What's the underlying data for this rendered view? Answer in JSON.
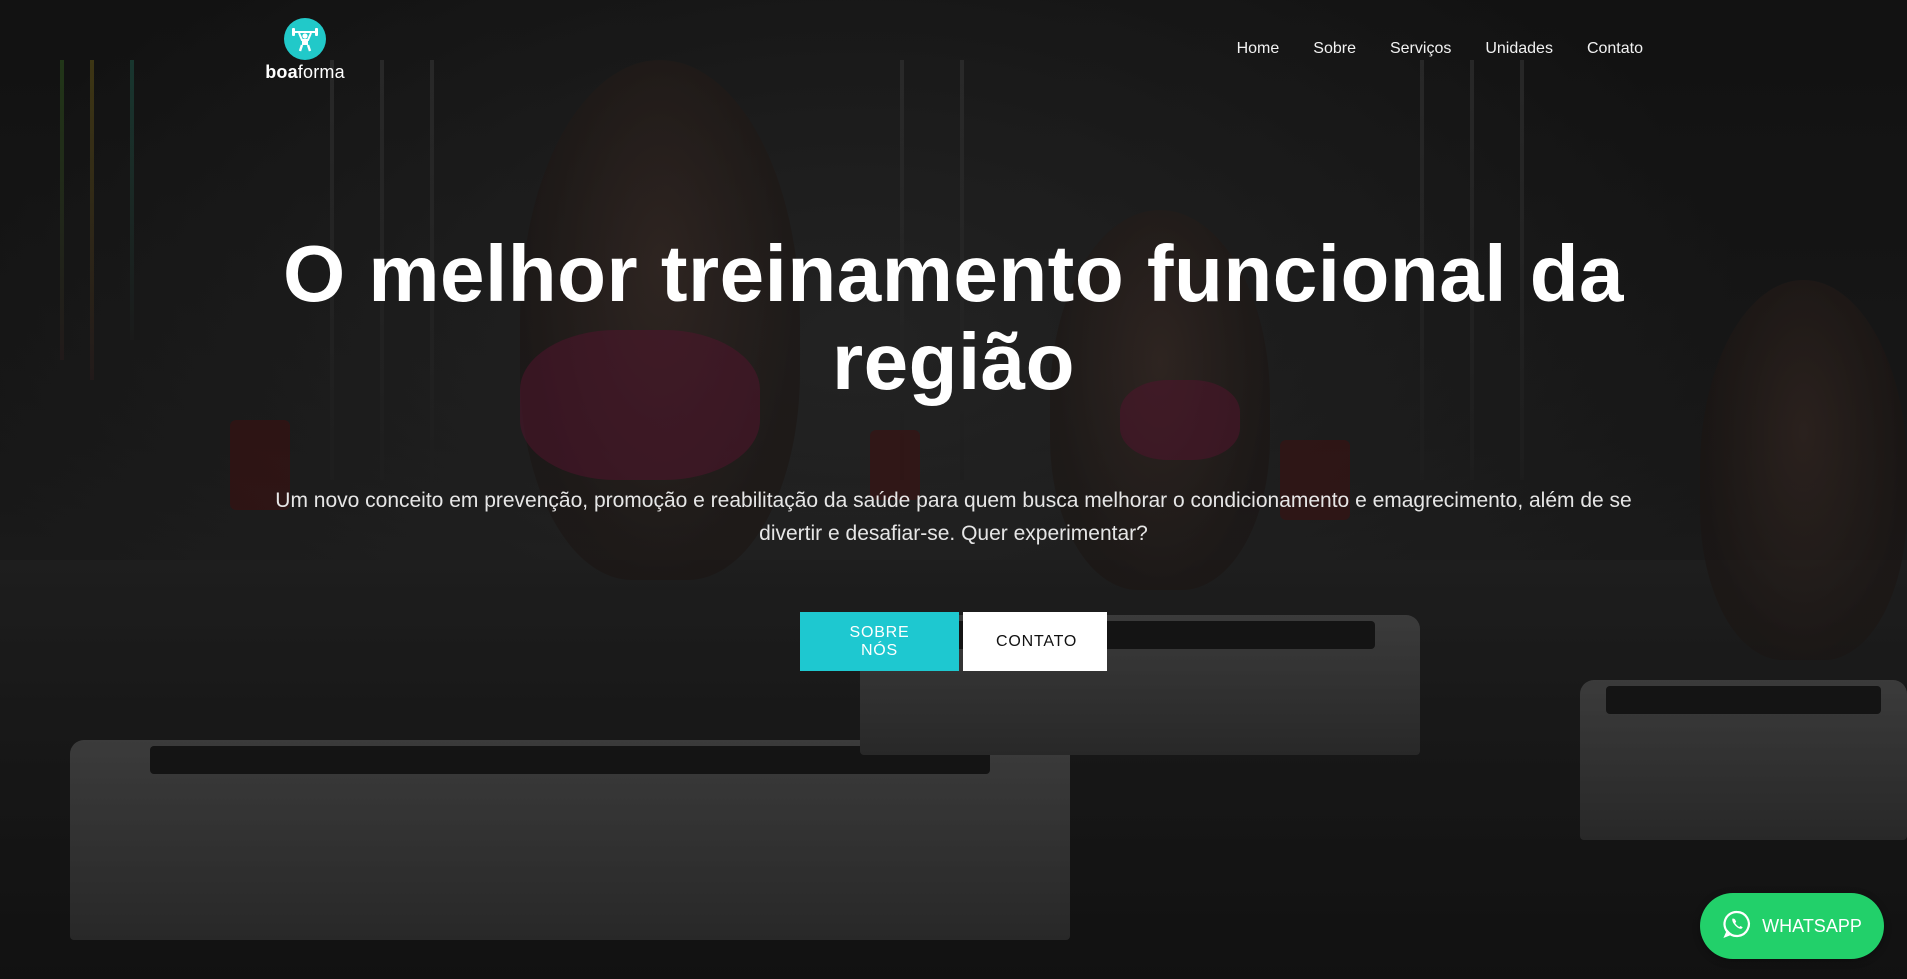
{
  "brand": {
    "logo_icon": "weightlifter-icon",
    "name_bold": "boa",
    "name_light": "forma",
    "accent_color": "#1ec8d0"
  },
  "nav": {
    "items": [
      {
        "label": "Home"
      },
      {
        "label": "Sobre"
      },
      {
        "label": "Serviços"
      },
      {
        "label": "Unidades"
      },
      {
        "label": "Contato"
      }
    ]
  },
  "hero": {
    "headline": "O melhor treinamento funcional da região",
    "subtitle": "Um novo conceito em prevenção, promoção e reabilitação da saúde para quem busca melhorar o condicionamento e emagrecimento, além de se divertir e desafiar-se. Quer experimentar?",
    "primary_button": "SOBRE NÓS",
    "secondary_button": "CONTATO"
  },
  "whatsapp": {
    "icon": "whatsapp-icon",
    "label": "WHATSAPP",
    "color": "#22d06a"
  }
}
